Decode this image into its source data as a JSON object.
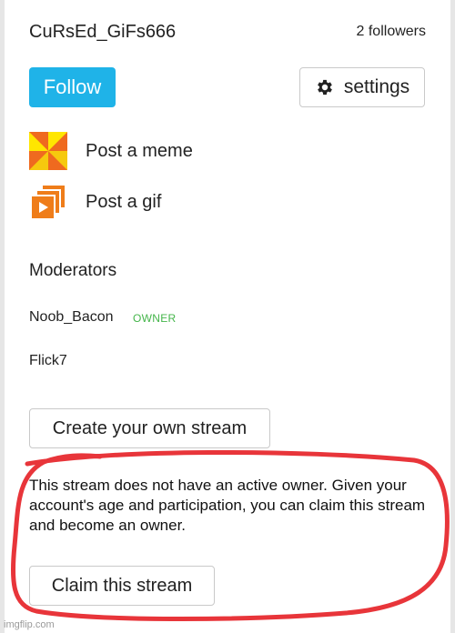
{
  "header": {
    "stream_name": "CuRsEd_GiFs666",
    "followers": "2 followers"
  },
  "actions": {
    "follow_label": "Follow",
    "settings_label": "settings",
    "settings_icon": "gear-icon"
  },
  "posts": {
    "meme_label": "Post a meme",
    "meme_icon": "pinwheel-meme-icon",
    "gif_label": "Post a gif",
    "gif_icon": "stacked-gif-play-icon"
  },
  "moderators": {
    "title": "Moderators",
    "items": [
      {
        "name": "Noob_Bacon",
        "badge": "OWNER"
      },
      {
        "name": "Flick7"
      }
    ]
  },
  "create_stream_label": "Create your own stream",
  "claim": {
    "text": "This stream does not have an active owner. Given your account's age and participation, you can claim this stream and become an owner.",
    "button_label": "Claim this stream"
  },
  "colors": {
    "follow": "#1fb3e8",
    "owner_badge": "#44b54a",
    "highlight": "#e8353a"
  },
  "watermark": "imgflip.com"
}
